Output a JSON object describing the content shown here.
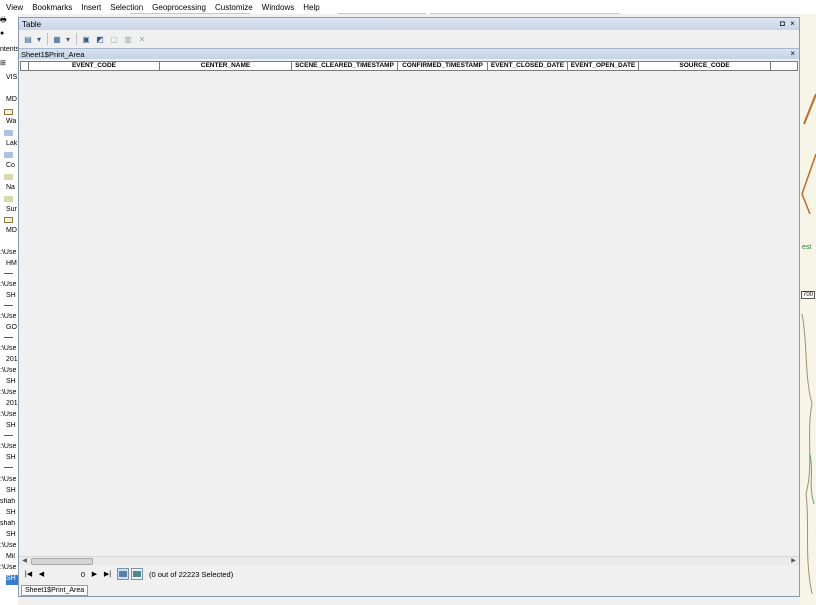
{
  "menu": {
    "items": [
      "View",
      "Bookmarks",
      "Insert",
      "Selection",
      "Geoprocessing",
      "Customize",
      "Windows",
      "Help"
    ]
  },
  "table_window": {
    "title": "Table",
    "pin_label": "◘",
    "close_label": "×",
    "tab_title": "Sheet1$Print_Area",
    "tab_close_label": "×"
  },
  "toolbar": {
    "icons": [
      "table-options-icon",
      "related-tables-icon",
      "select-by-attributes-icon",
      "switch-selection-icon",
      "clear-selection-icon",
      "zoom-to-selected-icon",
      "delete-selected-icon"
    ]
  },
  "grid": {
    "columns": [
      "EVENT_CODE",
      "CENTER_NAME",
      "SCENE_CLEARED_TIMESTAMP",
      "CONFIRMED_TIMESTAMP",
      "EVENT_CLOSED_DATE",
      "EVENT_OPEN_DATE",
      "SOURCE_CODE",
      ""
    ]
  },
  "navigation": {
    "first": "|◀",
    "prev": "◀",
    "record": "0",
    "next": "▶",
    "last": "▶|",
    "status": "(0 out of 22223 Selected)"
  },
  "bottom_tab": "Sheet1$Print_Area",
  "toc": {
    "label_fragments": [
      "VIS",
      "MD",
      "Wa",
      "Lak",
      "Co",
      "Na",
      "Sur",
      "MD",
      ":\\Use",
      "HM",
      ":\\Use",
      "SH",
      ":\\Use",
      "SH",
      "GO",
      ":\\Use",
      "201",
      ":\\Use",
      "SH",
      ":\\Use",
      "201",
      ":\\Use",
      "SH",
      ":\\Use",
      "SH",
      ":\\Use",
      "SH",
      "shah",
      "SH",
      "shah",
      "SH",
      ":\\Use",
      "Mil",
      ":\\Use",
      "SH"
    ],
    "header_fragment": "ntents"
  },
  "map": {
    "label": "700",
    "text_fragment": "est"
  },
  "colors": {
    "title_bar": "#dce6f2",
    "accent": "#3a5a8a"
  }
}
